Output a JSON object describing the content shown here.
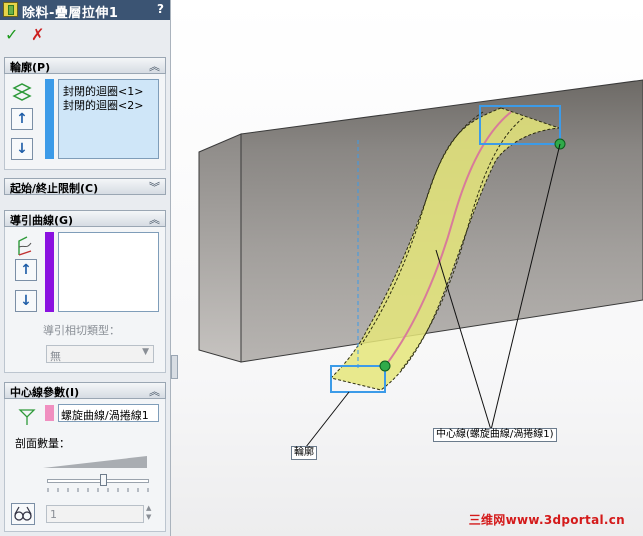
{
  "window": {
    "title": "除料-疊層拉伸1",
    "help": "?"
  },
  "actions": {
    "ok": "✓",
    "cancel": "✗"
  },
  "profiles": {
    "header": "輪廓(P)",
    "items": [
      "封閉的迴圈<1>",
      "封閉的迴圈<2>"
    ],
    "color": "#3c9be8"
  },
  "start_end": {
    "header": "起始/終止限制(C)"
  },
  "guides": {
    "header": "導引曲線(G)",
    "items": [],
    "color": "#8a11e0",
    "tangency_label": "導引相切類型：",
    "tangency_value": "無"
  },
  "centerline": {
    "header": "中心線參數(I)",
    "value": "螺旋曲線/渦捲線1",
    "color": "#f08fc0",
    "sections_label": "剖面數量：",
    "sections_fraction": 0.55,
    "spin_value": "1"
  },
  "viewport": {
    "callout_profile": "輪廓",
    "callout_centerline": "中心線(螺旋曲線/渦捲線1)",
    "watermark": "三维网www.3dportal.cn"
  }
}
